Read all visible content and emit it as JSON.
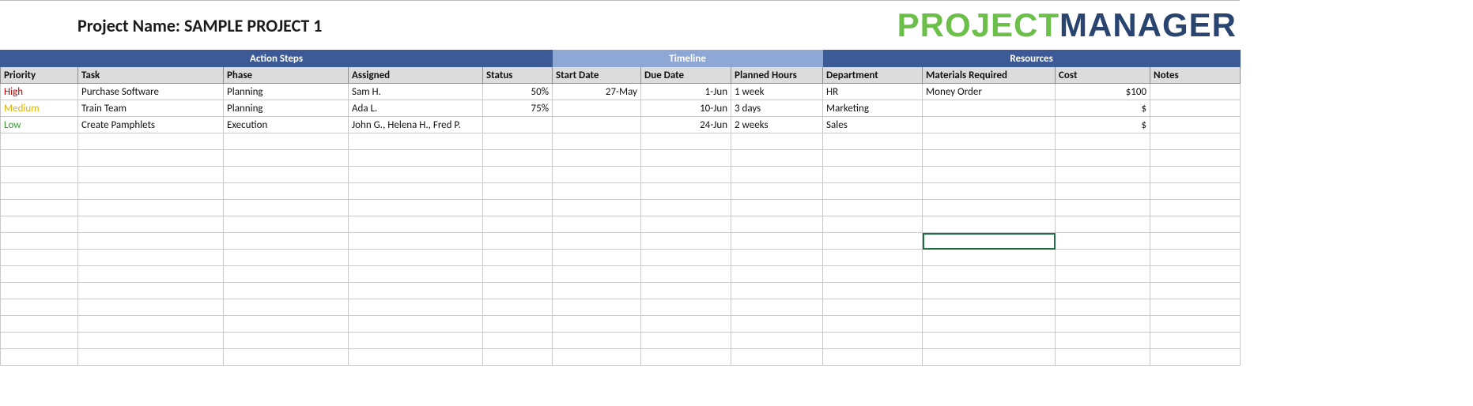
{
  "title": "Project Name: SAMPLE PROJECT 1",
  "logo": {
    "part1": "PROJECT",
    "part2": "MANAGER"
  },
  "groups": {
    "action_steps": "Action Steps",
    "timeline": "Timeline",
    "resources": "Resources"
  },
  "columns": {
    "priority": "Priority",
    "task": "Task",
    "phase": "Phase",
    "assigned": "Assigned",
    "status": "Status",
    "start": "Start Date",
    "due": "Due Date",
    "planned": "Planned Hours",
    "dept": "Department",
    "materials": "Materials Required",
    "cost": "Cost",
    "notes": "Notes"
  },
  "rows": [
    {
      "priority": "High",
      "priority_class": "prio-high",
      "task": "Purchase Software",
      "phase": "Planning",
      "assigned": "Sam H.",
      "status": "50%",
      "start": "27-May",
      "due": "1-Jun",
      "planned": "1 week",
      "dept": "HR",
      "materials": "Money Order",
      "cost": "$100",
      "notes": ""
    },
    {
      "priority": "Medium",
      "priority_class": "prio-medium",
      "task": "Train Team",
      "phase": "Planning",
      "assigned": "Ada L.",
      "status": "75%",
      "start": "",
      "due": "10-Jun",
      "planned": "3 days",
      "dept": "Marketing",
      "materials": "",
      "cost": "$",
      "notes": ""
    },
    {
      "priority": "Low",
      "priority_class": "prio-low",
      "task": "Create Pamphlets",
      "phase": "Execution",
      "assigned": "John G., Helena H., Fred P.",
      "status": "",
      "start": "",
      "due": "24-Jun",
      "planned": "2 weeks",
      "dept": "Sales",
      "materials": "",
      "cost": "$",
      "notes": ""
    }
  ],
  "empty_rows": 14,
  "selected_cell": {
    "row": 9,
    "col": 9
  }
}
